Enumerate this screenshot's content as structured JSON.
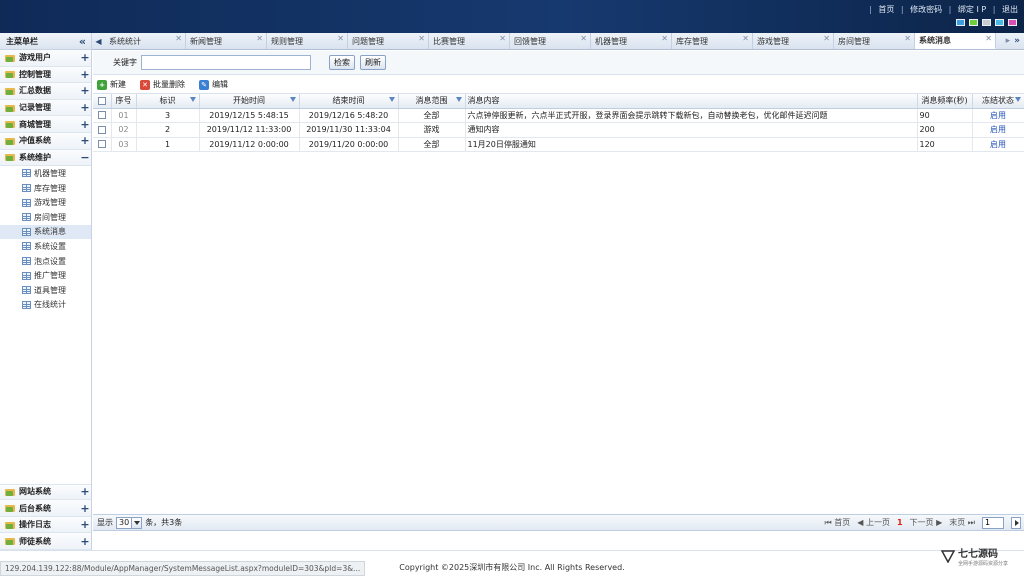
{
  "header": {
    "links": [
      "首页",
      "修改密码",
      "绑定 I P",
      "退出"
    ],
    "swatch_colors": [
      "#3aa0e0",
      "#6fcf3a",
      "#c8ccd2",
      "#49b8e6",
      "#d94fb5"
    ]
  },
  "sidebar": {
    "title": "主菜单栏",
    "collapse_icon": "double-chevron-left-icon",
    "top_items": [
      {
        "label": "游戏用户",
        "toggle": "+"
      },
      {
        "label": "控制管理",
        "toggle": "+"
      },
      {
        "label": "汇总数据",
        "toggle": "+"
      },
      {
        "label": "记录管理",
        "toggle": "+"
      },
      {
        "label": "商城管理",
        "toggle": "+"
      },
      {
        "label": "冲值系统",
        "toggle": "+"
      },
      {
        "label": "系统维护",
        "toggle": "−"
      }
    ],
    "sub_items": [
      "机器管理",
      "库存管理",
      "游戏管理",
      "房间管理",
      "系统消息",
      "系统设置",
      "泡点设置",
      "推广管理",
      "道具管理",
      "在线统计"
    ],
    "active_sub": "系统消息",
    "bottom_items": [
      {
        "label": "网站系统",
        "toggle": "+"
      },
      {
        "label": "后台系统",
        "toggle": "+"
      },
      {
        "label": "操作日志",
        "toggle": "+"
      },
      {
        "label": "师徒系统",
        "toggle": "+"
      }
    ]
  },
  "tabs": {
    "items": [
      "系统统计",
      "新闻管理",
      "规则管理",
      "问题管理",
      "比赛管理",
      "回馈管理",
      "机器管理",
      "库存管理",
      "游戏管理",
      "房间管理",
      "系统消息"
    ],
    "active": "系统消息"
  },
  "search": {
    "keyword_label": "关键字",
    "value": "",
    "search_button": "检索",
    "refresh_button": "刷新"
  },
  "toolbar": {
    "new_label": "新建",
    "batch_delete_label": "批量删除",
    "edit_label": "编辑",
    "colors": {
      "new": "#3fa33a",
      "delete": "#d94a3a",
      "edit": "#3a7fd1"
    }
  },
  "table": {
    "columns": [
      "序号",
      "标识",
      "开始时间",
      "结束时间",
      "消息范围",
      "消息内容",
      "消息频率(秒)",
      "冻结状态"
    ],
    "rows": [
      {
        "seq": "01",
        "id": "3",
        "start": "2019/12/15 5:48:15",
        "end": "2019/12/16 5:48:20",
        "scope": "全部",
        "content": "六点钟停服更新，六点半正式开服，登录界面会提示跳转下载新包，自动替换老包，优化邮件延迟问题",
        "freq": "90",
        "status": "启用"
      },
      {
        "seq": "02",
        "id": "2",
        "start": "2019/11/12 11:33:00",
        "end": "2019/11/30 11:33:04",
        "scope": "游戏",
        "content": "通知内容",
        "freq": "200",
        "status": "启用"
      },
      {
        "seq": "03",
        "id": "1",
        "start": "2019/11/12 0:00:00",
        "end": "2019/11/20 0:00:00",
        "scope": "全部",
        "content": "11月20日停服通知",
        "freq": "120",
        "status": "启用"
      }
    ]
  },
  "pager": {
    "show_label": "显示",
    "page_size": "30",
    "summary": "条，共3条",
    "first": "首页",
    "prev": "上一页",
    "current": "1",
    "next": "下一页",
    "last": "末页",
    "goto_value": "1"
  },
  "footer": {
    "copyright": "Copyright ©2025深圳市有限公司 Inc. All Rights Reserved.",
    "status_url": "129.204.139.122:88/Module/AppManager/SystemMessageList.aspx?moduleID=303&pId=3&...",
    "watermark_title": "七七源码",
    "watermark_sub": "全网手游源码资源分享"
  }
}
